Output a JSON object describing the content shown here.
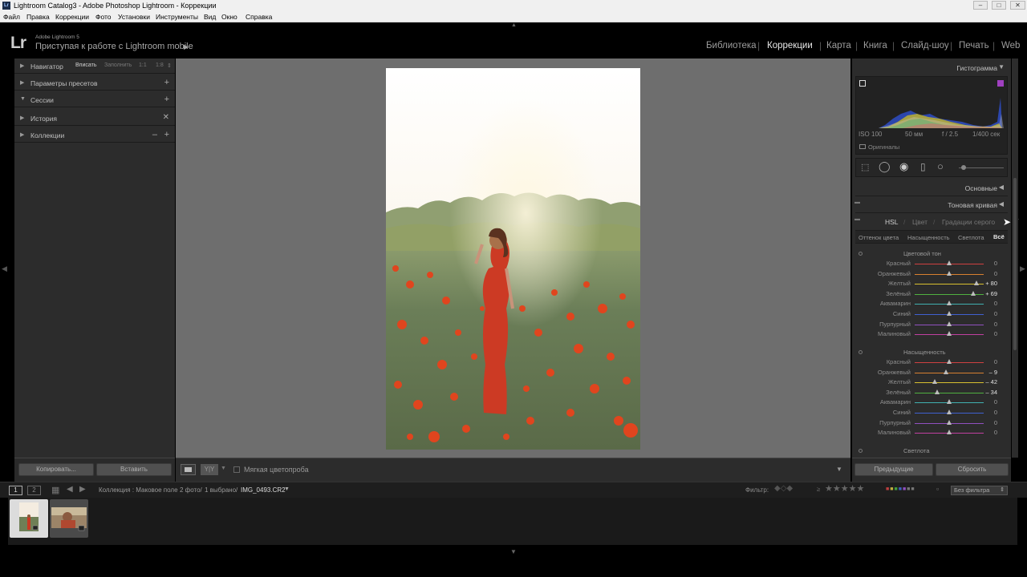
{
  "window": {
    "title": "Lightroom Catalog3 - Adobe Photoshop Lightroom - Коррекции"
  },
  "menu": [
    "Файл",
    "Правка",
    "Коррекции",
    "Фото",
    "Установки",
    "Инструменты",
    "Вид",
    "Окно",
    "Справка"
  ],
  "identity": {
    "product": "Adobe Lightroom 5",
    "tagline": "Приступая к работе с Lightroom mobile"
  },
  "modules": [
    "Библиотека",
    "Коррекции",
    "Карта",
    "Книга",
    "Слайд-шоу",
    "Печать",
    "Web"
  ],
  "active_module": "Коррекции",
  "left_panel": {
    "navigator": {
      "label": "Навигатор",
      "fit": "Вписать",
      "fill": "Заполнить",
      "r1": "1:1",
      "r2": "1:8"
    },
    "presets": {
      "label": "Параметры пресетов"
    },
    "snapshots": {
      "label": "Сессии"
    },
    "history": {
      "label": "История"
    },
    "collections": {
      "label": "Коллекции"
    },
    "copy_label": "Копировать...",
    "paste_label": "Вставить"
  },
  "toolbar": {
    "softproof_label": "Мягкая цветопроба"
  },
  "right_panel": {
    "histogram_label": "Гистограмма",
    "iso": "ISO 100",
    "focal": "50 мм",
    "aperture": "f / 2.5",
    "shutter": "1/400 сек",
    "original_label": "Оригиналы",
    "basic_label": "Основные",
    "tone_curve_label": "Тоновая кривая",
    "hsl_tabs": {
      "hsl": "HSL",
      "color": "Цвет",
      "gray": "Градации серого"
    },
    "hsl_subtabs": [
      "Оттенок цвета",
      "Насыщенность",
      "Светлота",
      "Всё"
    ],
    "hue_group": {
      "title": "Цветовой тон",
      "rows": [
        {
          "name": "Красный",
          "value": "0",
          "amount": 0
        },
        {
          "name": "Оранжевый",
          "value": "0",
          "amount": 0
        },
        {
          "name": "Желтый",
          "value": "+ 80",
          "amount": 80
        },
        {
          "name": "Зелёный",
          "value": "+ 69",
          "amount": 69
        },
        {
          "name": "Аквамарин",
          "value": "0",
          "amount": 0
        },
        {
          "name": "Синий",
          "value": "0",
          "amount": 0
        },
        {
          "name": "Пурпурный",
          "value": "0",
          "amount": 0
        },
        {
          "name": "Малиновый",
          "value": "0",
          "amount": 0
        }
      ]
    },
    "sat_group": {
      "title": "Насыщенность",
      "rows": [
        {
          "name": "Красный",
          "value": "0",
          "amount": 0
        },
        {
          "name": "Оранжевый",
          "value": "– 9",
          "amount": -9
        },
        {
          "name": "Желтый",
          "value": "– 42",
          "amount": -42
        },
        {
          "name": "Зелёный",
          "value": "– 34",
          "amount": -34
        },
        {
          "name": "Аквамарин",
          "value": "0",
          "amount": 0
        },
        {
          "name": "Синий",
          "value": "0",
          "amount": 0
        },
        {
          "name": "Пурпурный",
          "value": "0",
          "amount": 0
        },
        {
          "name": "Малиновый",
          "value": "0",
          "amount": 0
        }
      ]
    },
    "lum_group_title": "Светлота",
    "previous_label": "Предыдущие",
    "reset_label": "Сбросить"
  },
  "filmstrip_bar": {
    "page1": "1",
    "page2": "2",
    "source": "Коллекция : Маковое поле",
    "count": "2 фото/",
    "selected": "1 выбрано/",
    "filename": "IMG_0493.CR2",
    "filter_label": "Фильтр:",
    "filter_value": "Без фильтра"
  },
  "slider_colors": [
    "#d04040",
    "#d88030",
    "#d8c030",
    "#50b040",
    "#40b0b0",
    "#4060d0",
    "#9050c0",
    "#c040a0"
  ],
  "accent": "#e8e8e8"
}
